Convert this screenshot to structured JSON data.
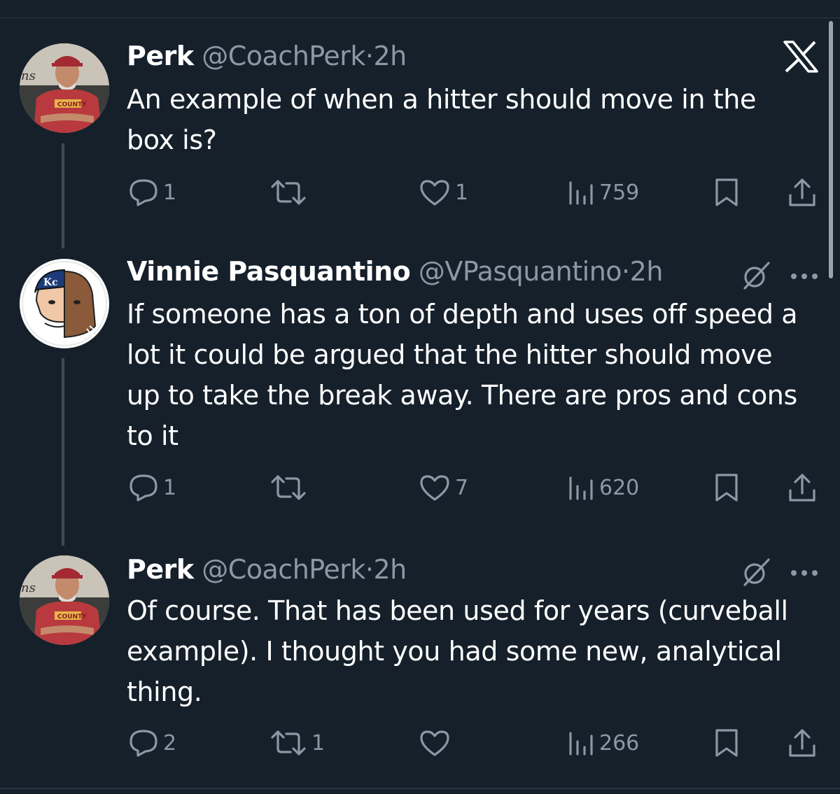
{
  "tweets": [
    {
      "name": "Perk",
      "handle": "@CoachPerk",
      "time": "2h",
      "text": "An example of when a hitter should move in the box is?",
      "replies": "1",
      "retweets": "",
      "likes": "1",
      "views": "759"
    },
    {
      "name": "Vinnie Pasquantino",
      "handle": "@VPasquantino",
      "time": "2h",
      "text": "If someone has a ton of depth and uses off speed a lot it could be argued that the hitter should move up to take the break away. There are pros and cons to it",
      "replies": "1",
      "retweets": "",
      "likes": "7",
      "views": "620"
    },
    {
      "name": "Perk",
      "handle": "@CoachPerk",
      "time": "2h",
      "text": "Of course.  That has been used for years (curveball example).  I thought you had some new, analytical thing.",
      "replies": "2",
      "retweets": "1",
      "likes": "",
      "views": "266"
    }
  ],
  "separator": "·",
  "icons": {
    "close": "x-logo-icon",
    "grok": "grok-icon",
    "more": "more-icon",
    "reply": "reply-icon",
    "retweet": "retweet-icon",
    "like": "heart-icon",
    "views": "views-icon",
    "bookmark": "bookmark-icon",
    "share": "share-icon"
  },
  "colors": {
    "background": "#15202b",
    "text": "#ffffff",
    "muted": "#8b98a5",
    "thread_line": "#3d4a57"
  }
}
